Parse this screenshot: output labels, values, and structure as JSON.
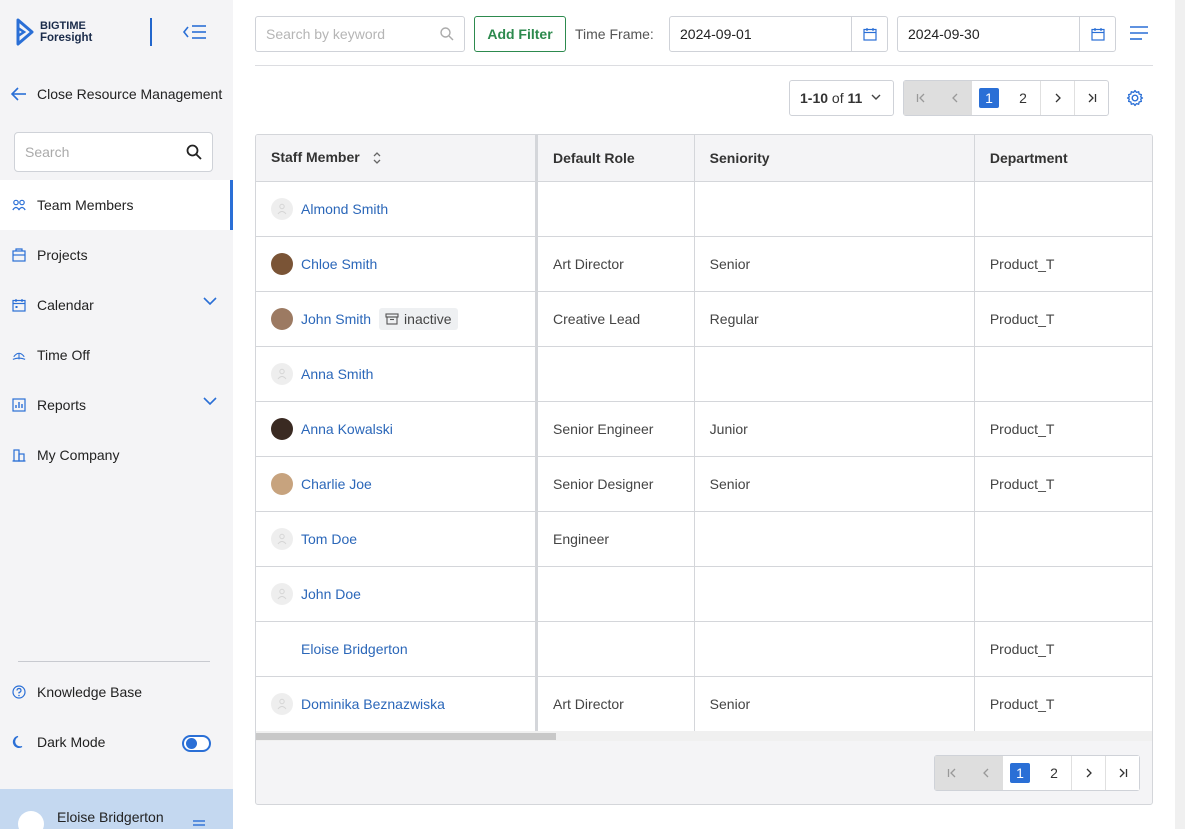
{
  "brand": {
    "line1": "BIGTIME",
    "line2": "Foresight",
    "color": "#2a6fd6"
  },
  "sidebar": {
    "back_label": "Close Resource Management",
    "search_placeholder": "Search",
    "items": [
      {
        "label": "Team Members",
        "icon": "team-icon",
        "active": true
      },
      {
        "label": "Projects",
        "icon": "projects-icon"
      },
      {
        "label": "Calendar",
        "icon": "calendar-icon",
        "expandable": true
      },
      {
        "label": "Time Off",
        "icon": "time-off-icon"
      },
      {
        "label": "Reports",
        "icon": "reports-icon",
        "expandable": true
      },
      {
        "label": "My Company",
        "icon": "company-icon"
      }
    ],
    "knowledge_base": "Knowledge Base",
    "dark_mode": "Dark Mode",
    "user_name": "Eloise Bridgerton"
  },
  "toolbar": {
    "search_placeholder": "Search by keyword",
    "add_filter": "Add Filter",
    "time_frame_label": "Time Frame:",
    "start_date": "2024-09-01",
    "end_date": "2024-09-30"
  },
  "pagination": {
    "range": "1-10",
    "of_label": "of",
    "total": "11",
    "pages": [
      "1",
      "2"
    ],
    "current": "1"
  },
  "table": {
    "columns": [
      "Staff Member",
      "Default Role",
      "Seniority",
      "Department"
    ],
    "rows": [
      {
        "name": "Almond Smith",
        "role": "",
        "seniority": "",
        "department": "",
        "avatar": "empty"
      },
      {
        "name": "Chloe Smith",
        "role": "Art Director",
        "seniority": "Senior",
        "department": "Product_T",
        "avatar": "photo"
      },
      {
        "name": "John Smith",
        "role": "Creative Lead",
        "seniority": "Regular",
        "department": "Product_T",
        "avatar": "photo3",
        "badge": "inactive"
      },
      {
        "name": "Anna Smith",
        "role": "",
        "seniority": "",
        "department": "",
        "avatar": "empty"
      },
      {
        "name": "Anna Kowalski",
        "role": "Senior Engineer",
        "seniority": "Junior",
        "department": "Product_T",
        "avatar": "photo4"
      },
      {
        "name": "Charlie Joe",
        "role": "Senior Designer",
        "seniority": "Senior",
        "department": "Product_T",
        "avatar": "photo5"
      },
      {
        "name": "Tom Doe",
        "role": "Engineer",
        "seniority": "",
        "department": "",
        "avatar": "empty"
      },
      {
        "name": "John Doe",
        "role": "",
        "seniority": "",
        "department": "",
        "avatar": "empty"
      },
      {
        "name": "Eloise Bridgerton",
        "role": "",
        "seniority": "",
        "department": "Product_T",
        "avatar": "white"
      },
      {
        "name": "Dominika Beznazwiska",
        "role": "Art Director",
        "seniority": "Senior",
        "department": "Product_T",
        "avatar": "empty"
      }
    ]
  }
}
